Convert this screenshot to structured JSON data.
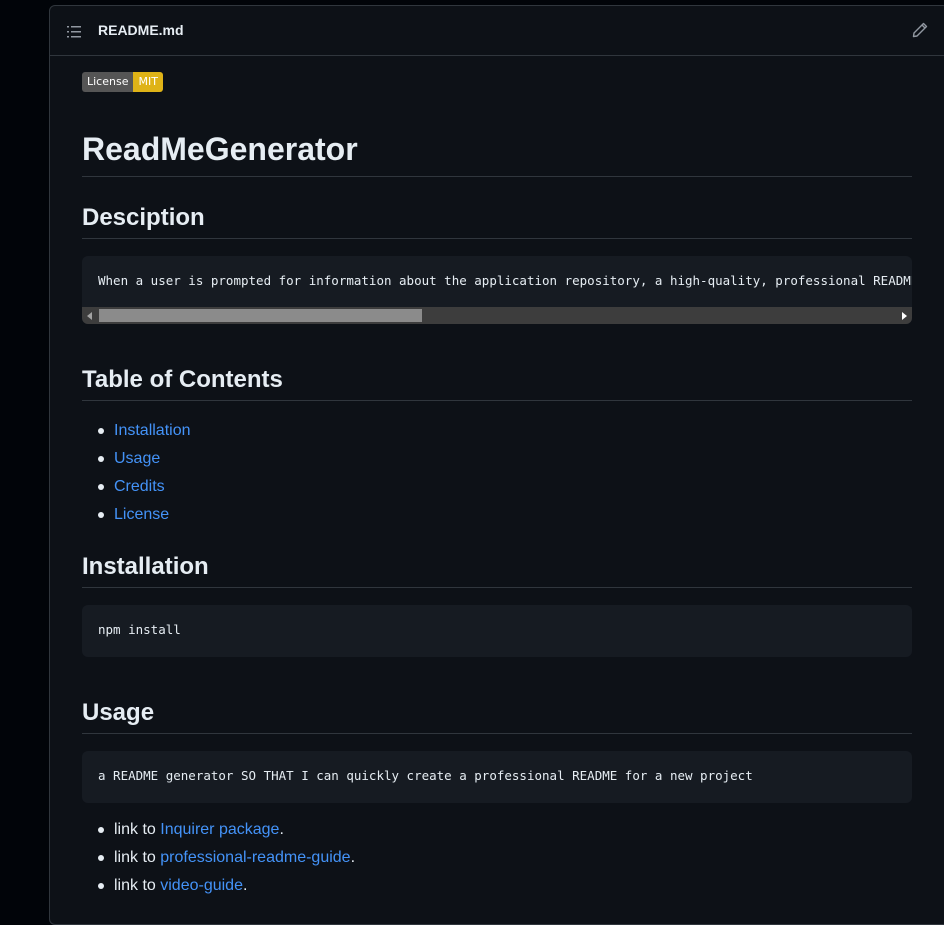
{
  "header": {
    "file_name": "README.md",
    "toc_icon": "list-icon",
    "edit_icon": "pencil-icon"
  },
  "badge": {
    "label": "License",
    "value": "MIT",
    "label_color": "#555555",
    "value_color": "#dfb317"
  },
  "title": "ReadMeGenerator",
  "description": {
    "heading": "Desciption",
    "code": "When a user is prompted for information about the application repository, a high-quality, professional README"
  },
  "toc": {
    "heading": "Table of Contents",
    "items": [
      "Installation",
      "Usage",
      "Credits",
      "License"
    ]
  },
  "installation": {
    "heading": "Installation",
    "code": "npm install"
  },
  "usage": {
    "heading": "Usage",
    "code": "a README generator SO THAT I can quickly create a professional README for a new project",
    "links": [
      {
        "prefix": "link to ",
        "text": "Inquirer package",
        "suffix": "."
      },
      {
        "prefix": "link to ",
        "text": "professional-readme-guide",
        "suffix": "."
      },
      {
        "prefix": "link to ",
        "text": "video-guide",
        "suffix": "."
      }
    ]
  },
  "colors": {
    "link": "#4493f8",
    "background": "#0d1117",
    "code_background": "#161b22"
  }
}
